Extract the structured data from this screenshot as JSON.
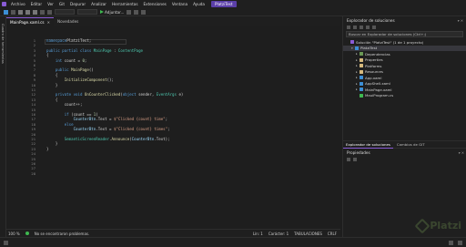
{
  "menubar": {
    "items": [
      "Archivo",
      "Editar",
      "Ver",
      "Git",
      "Depurar",
      "Analizar",
      "Herramientas",
      "Extensiones",
      "Ventana",
      "Ayuda"
    ],
    "project_badge": "PlatziTest"
  },
  "toolbar": {
    "run_label": "Adjuntar..."
  },
  "left_strip": {
    "label": "Cuadro de herramientas"
  },
  "tabs": [
    {
      "label": "MainPage.xaml.cs",
      "active": true
    },
    {
      "label": "Novedades",
      "active": false
    }
  ],
  "editor": {
    "line_numbers": [
      "1",
      "2",
      "3",
      "4",
      "5",
      "6",
      "7",
      "8",
      "9",
      "10",
      "11",
      "12",
      "13",
      "14",
      "15",
      "16",
      "17",
      "18",
      "19",
      "20",
      "21",
      "22",
      "23",
      "24",
      "25",
      "26",
      "27",
      "28"
    ],
    "zoom": "100 %",
    "issues": "No se encontraron problemas.",
    "position": {
      "line": "Lín: 1",
      "char": "Carácter: 1",
      "mode": "TABULACIONES",
      "eol": "CRLF"
    }
  },
  "code": [
    {
      "t": [
        [
          "kw",
          "namespace"
        ],
        [
          "",
          "PlatziTest;"
        ]
      ]
    },
    {
      "t": []
    },
    {
      "t": [
        [
          "kw",
          "public partial class"
        ],
        [
          "",
          " "
        ],
        [
          "ty",
          "MainPage"
        ],
        [
          "",
          " : "
        ],
        [
          "ty",
          "ContentPage"
        ]
      ]
    },
    {
      "t": [
        [
          "",
          "{"
        ]
      ]
    },
    {
      "t": [
        [
          "",
          "    "
        ],
        [
          "kw",
          "int"
        ],
        [
          "",
          " count = "
        ],
        [
          "num",
          "0"
        ],
        [
          "",
          ";"
        ]
      ]
    },
    {
      "t": []
    },
    {
      "t": [
        [
          "",
          "    "
        ],
        [
          "kw",
          "public"
        ],
        [
          "",
          " "
        ],
        [
          "mt",
          "MainPage"
        ],
        [
          "",
          "()"
        ]
      ]
    },
    {
      "t": [
        [
          "",
          "    {"
        ]
      ]
    },
    {
      "t": [
        [
          "",
          "        "
        ],
        [
          "mt",
          "InitializeComponent"
        ],
        [
          "",
          "();"
        ]
      ]
    },
    {
      "t": [
        [
          "",
          "    }"
        ]
      ]
    },
    {
      "t": []
    },
    {
      "t": [
        [
          "",
          "    "
        ],
        [
          "kw",
          "private void"
        ],
        [
          "",
          " "
        ],
        [
          "mt",
          "OnCounterClicked"
        ],
        [
          "",
          "("
        ],
        [
          "kw",
          "object"
        ],
        [
          "",
          " sender, "
        ],
        [
          "ty",
          "EventArgs"
        ],
        [
          "",
          " e)"
        ]
      ]
    },
    {
      "t": [
        [
          "",
          "    {"
        ]
      ]
    },
    {
      "t": [
        [
          "",
          "        count++;"
        ]
      ]
    },
    {
      "t": []
    },
    {
      "t": [
        [
          "",
          "        "
        ],
        [
          "kw",
          "if"
        ],
        [
          "",
          " (count == "
        ],
        [
          "num",
          "1"
        ],
        [
          "",
          ")"
        ]
      ]
    },
    {
      "t": [
        [
          "",
          "            "
        ],
        [
          "vr",
          "CounterBtn"
        ],
        [
          "",
          ".Text = "
        ],
        [
          "st",
          "$\"Clicked {count} time\""
        ],
        [
          "",
          ";"
        ]
      ]
    },
    {
      "t": [
        [
          "",
          "        "
        ],
        [
          "kw",
          "else"
        ]
      ]
    },
    {
      "t": [
        [
          "",
          "            "
        ],
        [
          "vr",
          "CounterBtn"
        ],
        [
          "",
          ".Text = "
        ],
        [
          "st",
          "$\"Clicked {count} times\""
        ],
        [
          "",
          ";"
        ]
      ]
    },
    {
      "t": []
    },
    {
      "t": [
        [
          "",
          "        "
        ],
        [
          "ty",
          "SemanticScreenReader"
        ],
        [
          "",
          "."
        ],
        [
          "mt",
          "Announce"
        ],
        [
          "",
          "("
        ],
        [
          "vr",
          "CounterBtn"
        ],
        [
          "",
          ".Text);"
        ]
      ]
    },
    {
      "t": [
        [
          "",
          "    }"
        ]
      ]
    },
    {
      "t": [
        [
          "",
          "}"
        ]
      ]
    },
    {
      "t": []
    },
    {
      "t": []
    },
    {
      "t": []
    },
    {
      "t": []
    },
    {
      "t": []
    }
  ],
  "solution_explorer": {
    "title": "Explorador de soluciones",
    "search_placeholder": "Buscar en Explorador de soluciones (Ctrl+;)",
    "rows": [
      {
        "label": "Solución \"PlatziTest\" (1 de 1 proyecto)",
        "indent": 0,
        "icon_color": "#8a5cd6",
        "arrow": "",
        "selected": false
      },
      {
        "label": "PlatziTest",
        "indent": 1,
        "icon_color": "#3c8fd6",
        "arrow": "▾",
        "selected": true
      },
      {
        "label": "Dependencias",
        "indent": 2,
        "icon_color": "#6a9955",
        "arrow": "▸",
        "selected": false
      },
      {
        "label": "Properties",
        "indent": 2,
        "icon_color": "#d7ba7d",
        "arrow": "▸",
        "selected": false
      },
      {
        "label": "Platforms",
        "indent": 2,
        "icon_color": "#d7ba7d",
        "arrow": "▸",
        "selected": false
      },
      {
        "label": "Resources",
        "indent": 2,
        "icon_color": "#d7ba7d",
        "arrow": "▸",
        "selected": false
      },
      {
        "label": "App.xaml",
        "indent": 2,
        "icon_color": "#3c8fd6",
        "arrow": "▸",
        "selected": false
      },
      {
        "label": "AppShell.xaml",
        "indent": 2,
        "icon_color": "#3c8fd6",
        "arrow": "▸",
        "selected": false
      },
      {
        "label": "MainPage.xaml",
        "indent": 2,
        "icon_color": "#3c8fd6",
        "arrow": "▸",
        "selected": false
      },
      {
        "label": "MauiProgram.cs",
        "indent": 2,
        "icon_color": "#3fb950",
        "arrow": "",
        "selected": false
      }
    ]
  },
  "bottom_tabs": {
    "solution": "Explorador de soluciones",
    "git": "Cambios de GIT"
  },
  "properties": {
    "title": "Propiedades"
  },
  "watermark": "Platzi"
}
